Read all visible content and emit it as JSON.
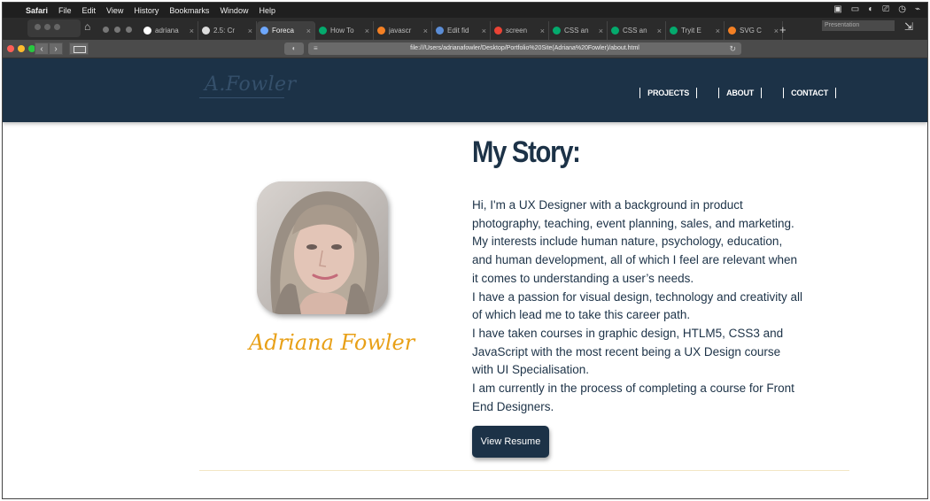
{
  "menubar": {
    "app": "Safari",
    "items": [
      "File",
      "Edit",
      "View",
      "History",
      "Bookmarks",
      "Window",
      "Help"
    ]
  },
  "tabs": [
    {
      "title": "adriana",
      "favicon": "github-icon",
      "color": "#ffffff"
    },
    {
      "title": "2.5: Cr",
      "favicon": "page-icon",
      "color": "#dddddd"
    },
    {
      "title": "Foreca",
      "favicon": "globe-icon",
      "color": "#6ea8ff",
      "active": true
    },
    {
      "title": "How To",
      "favicon": "w3schools-icon",
      "color": "#04aa6d"
    },
    {
      "title": "javascr",
      "favicon": "stack-icon",
      "color": "#f48024"
    },
    {
      "title": "Edit fid",
      "favicon": "edit-icon",
      "color": "#5b8dd6"
    },
    {
      "title": "screen",
      "favicon": "google-icon",
      "color": "#ea4335"
    },
    {
      "title": "CSS an",
      "favicon": "w3schools-icon",
      "color": "#04aa6d"
    },
    {
      "title": "CSS an",
      "favicon": "w3schools-icon",
      "color": "#04aa6d"
    },
    {
      "title": "Tryit E",
      "favicon": "w3schools-icon",
      "color": "#04aa6d"
    },
    {
      "title": "SVG C",
      "favicon": "stack-icon",
      "color": "#f48024"
    }
  ],
  "presentation_label": "Presentation",
  "url": "file:///Users/adrianafowler/Desktop/Portfolio%20Site(Adriana%20Fowler)/about.html",
  "site": {
    "logo": "A.Fowler",
    "nav": [
      "PROJECTS",
      "ABOUT",
      "CONTACT"
    ]
  },
  "profile": {
    "name": "Adriana Fowler"
  },
  "story": {
    "heading": "My Story:",
    "paragraphs": [
      "Hi, I'm a UX Designer with a background in product photography, teaching, event planning, sales, and marketing. My interests include human nature, psychology, education, and human development, all of which I feel are relevant when it comes to understanding a user’s needs.",
      "I have a passion for visual design, technology and creativity all of which lead me to take this career path.",
      "I have taken courses in graphic design, HTLM5, CSS3 and JavaScript with the most recent being a UX Design course with UI Specialisation.",
      "I am currently in the process of completing a course for Front End Designers."
    ],
    "button": "View Resume"
  },
  "colors": {
    "header_bg": "#1c3247",
    "name_accent": "#e8a017",
    "text": "#1c3247"
  }
}
